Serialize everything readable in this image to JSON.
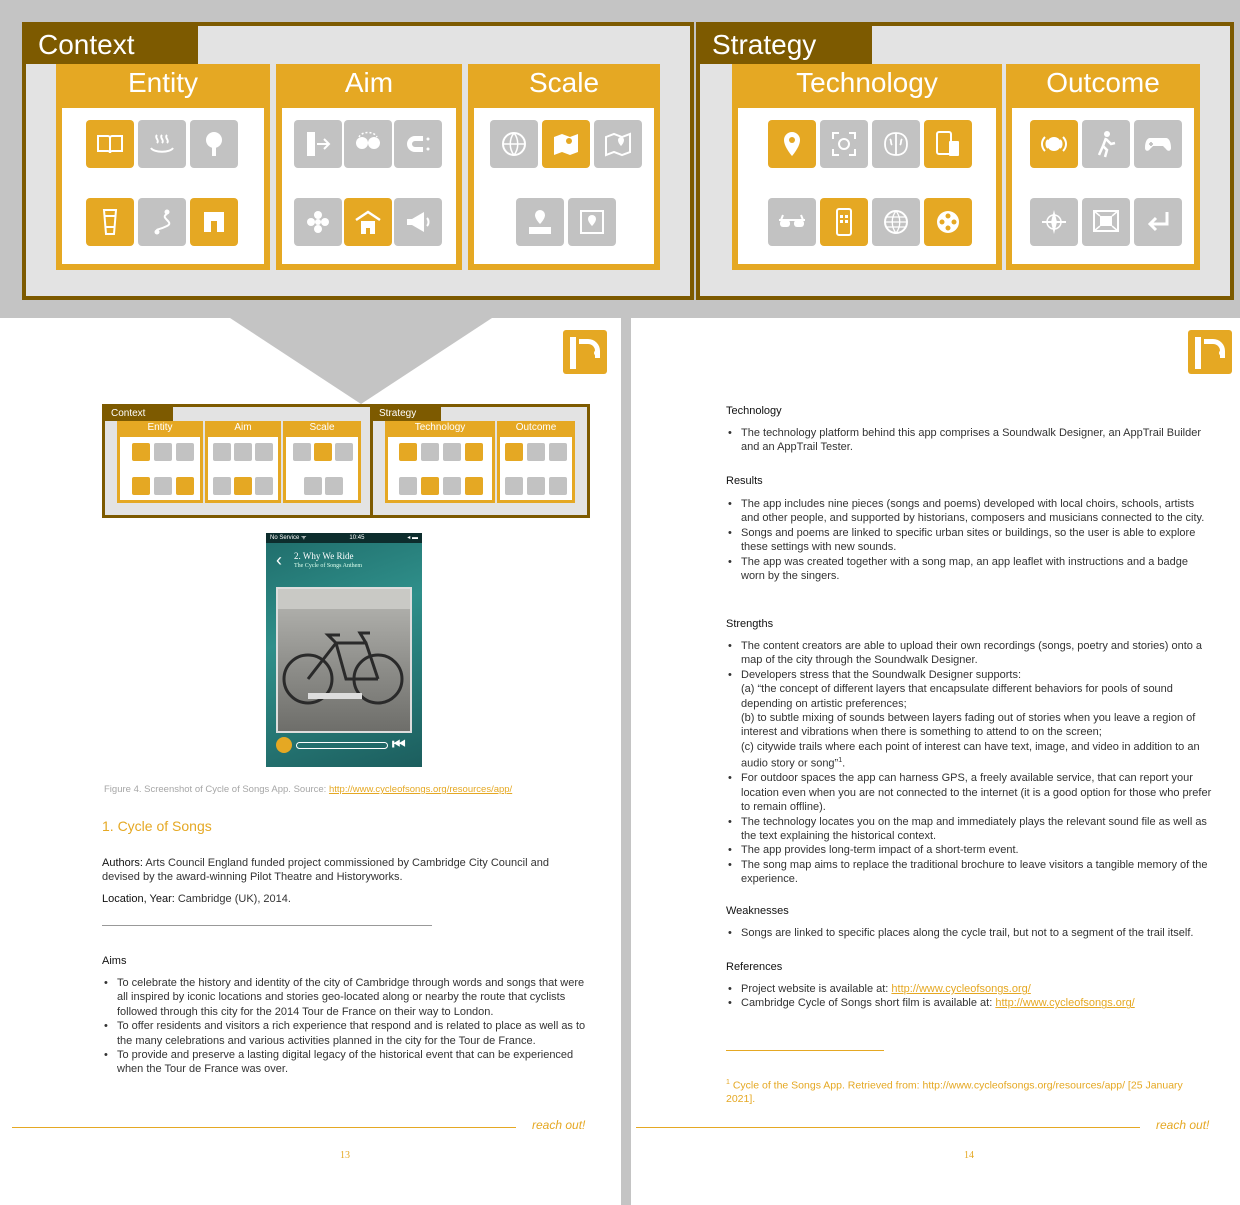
{
  "banner": {
    "context": {
      "title": "Context",
      "categories": [
        {
          "name": "Entity"
        },
        {
          "name": "Aim"
        },
        {
          "name": "Scale"
        }
      ]
    },
    "strategy": {
      "title": "Strategy",
      "categories": [
        {
          "name": "Technology"
        },
        {
          "name": "Outcome"
        }
      ]
    }
  },
  "mini": {
    "context": "Context",
    "strategy": "Strategy",
    "entity": "Entity",
    "aim": "Aim",
    "scale": "Scale",
    "technology": "Technology",
    "outcome": "Outcome"
  },
  "phone": {
    "status_left": "No Service ᯤ",
    "status_time": "10:45",
    "status_right": "◂ ▬",
    "title": "2. Why We Ride",
    "subtitle": "The Cycle of Songs Anthem",
    "back": "‹",
    "rewind": "⏮"
  },
  "left_page": {
    "caption": "Figure 4. Screenshot of Cycle of Songs App. Source: ",
    "caption_link": "http://www.cycleofsongs.org/resources/app/",
    "heading": "1.  Cycle of Songs",
    "authors_label": "Authors:",
    "authors_text": " Arts Council England funded project commissioned by Cambridge City Council and devised by the award-winning Pilot Theatre and Historyworks.",
    "location_label": "Location, Year:",
    "location_text": " Cambridge (UK), 2014.",
    "aims_title": "Aims",
    "aims": [
      "To celebrate the history and identity of the city of Cambridge through words and songs that were all inspired by iconic locations and stories geo-located along or nearby the route that cyclists followed through this city for the 2014 Tour de France on their way to London.",
      "To offer residents and visitors a rich experience that respond and is related to place as well as to the many celebrations and various activities planned in the city for the Tour de France.",
      "To provide and preserve a lasting digital legacy of the historical event that can be experienced when the Tour de France was over."
    ],
    "reach": "reach out!",
    "page_number": "13"
  },
  "right_page": {
    "technology_title": "Technology",
    "technology": [
      "The technology platform behind this app comprises a Soundwalk Designer, an AppTrail Builder and an AppTrail Tester."
    ],
    "results_title": "Results",
    "results": [
      "The app includes nine pieces (songs and poems) developed with local choirs, schools, artists and other people, and supported by historians, composers and musicians connected to the city.",
      "Songs and poems are linked to specific urban sites or buildings, so the user is able to explore these settings with new sounds.",
      "The app was created together with a song map, an app leaflet with instructions and a badge worn by the singers."
    ],
    "strengths_title": "Strengths",
    "strengths": [
      "The content creators are able to upload their own recordings (songs, poetry and stories) onto a map of the city through the Soundwalk Designer.",
      "Developers stress that the Soundwalk Designer supports:",
      "(a) “the concept of different layers that encapsulate different behaviors for pools of sound depending on artistic preferences;",
      "(b) to subtle mixing of sounds between layers fading out of stories when you leave a region of interest and vibrations when there is something to attend to on the screen;",
      "(c) citywide trails where each point of interest can have text, image, and video in addition to an audio story or song”",
      "For outdoor spaces the app can harness GPS, a freely available service, that can report your location even when you are not connected to the internet (it is a good option for those who prefer to remain offline).",
      "The technology locates you on the map and immediately plays the relevant sound file as well as the text explaining the historical context.",
      "The app provides long-term impact of a short-term event.",
      "The song map aims to replace the traditional brochure to leave visitors a tangible memory of the experience."
    ],
    "footnote_ref": "1",
    "weaknesses_title": "Weaknesses",
    "weaknesses": [
      "Songs are linked to specific places along the cycle trail, but not to a segment of the trail itself."
    ],
    "references_title": "References",
    "ref1_text": "Project website is available at: ",
    "ref1_link": "http://www.cycleofsongs.org/",
    "ref2_text": "Cambridge Cycle of Songs short film is available at: ",
    "ref2_link": "http://www.cycleofsongs.org/",
    "footnote_mark": "1",
    "footnote": " Cycle of the Songs App. Retrieved from: http://www.cycleofsongs.org/resources/app/ [25 January 2021].",
    "reach": "reach out!",
    "page_number": "14"
  },
  "colors": {
    "gold": "#e5a823",
    "brown": "#7d5a00",
    "grey": "#c4c4c4"
  }
}
